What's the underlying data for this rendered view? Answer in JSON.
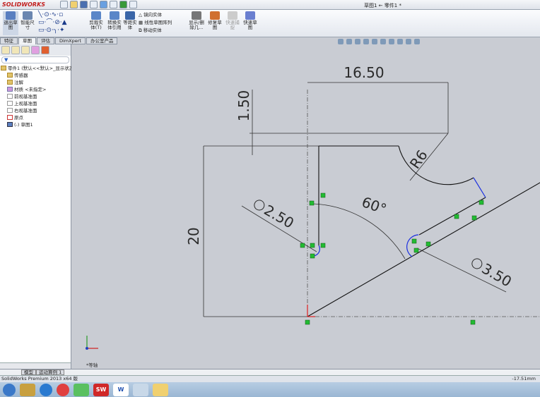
{
  "app": {
    "logo": "SOLIDWORKS",
    "doc_title": "草图1 ← 零件1 *"
  },
  "ribbon": {
    "items": [
      "退出草图",
      "智能尺寸",
      "剪裁实体(T)",
      "转换实体引用",
      "等距实体",
      "镜向实体",
      "线性草图阵列",
      "移动实体",
      "显示/删除几...",
      "修复草图",
      "快速捕捉",
      "快速草图"
    ]
  },
  "tabs": [
    "特征",
    "草图",
    "评估",
    "DimXpert",
    "办公室产品"
  ],
  "tree": {
    "root": "零件1 (默认<<默认>_显示状态",
    "items": [
      "传感器",
      "注解",
      "材质 <未指定>",
      "前视基准面",
      "上视基准面",
      "右视基准面",
      "原点",
      "(-) 草图1"
    ]
  },
  "sketch": {
    "dims": {
      "d1": "16.50",
      "d2": "1.50",
      "d3": "20",
      "d4": "R6",
      "d5": "60°",
      "d6": "2.50",
      "d7": "3.50"
    },
    "view_label": "*等轴"
  },
  "bottom_tabs": [
    "模型",
    "运动算例 1"
  ],
  "status": {
    "text": "SolidWorks Premium 2013 x64 版",
    "coord": "-17.51mm"
  },
  "taskbar": [
    "start",
    "app1",
    "app2",
    "app3",
    "ie",
    "solidworks",
    "word",
    "paint",
    "explorer"
  ]
}
